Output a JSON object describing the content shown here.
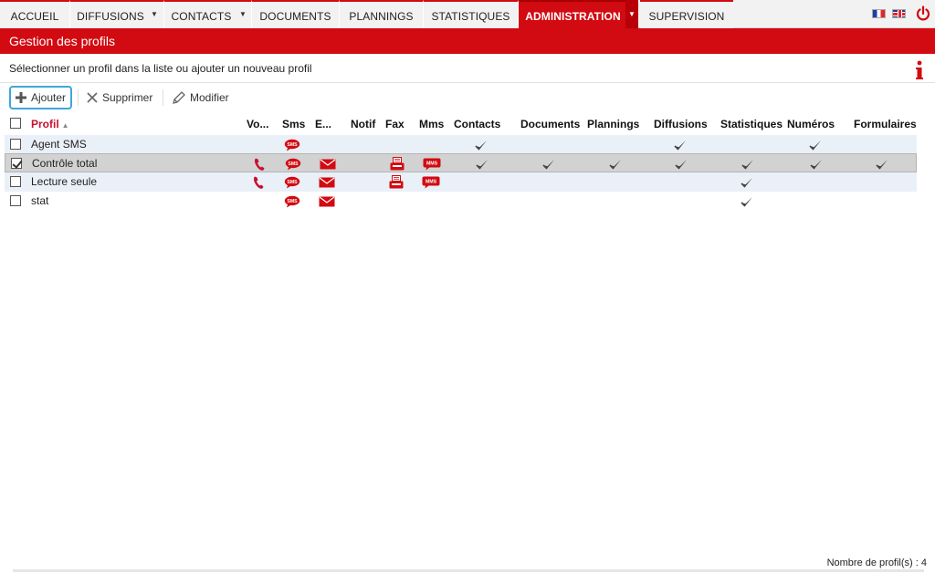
{
  "nav": {
    "tabs": [
      {
        "label": "ACCUEIL",
        "name": "tab-accueil"
      },
      {
        "label": "DIFFUSIONS",
        "name": "tab-diffusions",
        "dropdown": true
      },
      {
        "label": "CONTACTS",
        "name": "tab-contacts",
        "dropdown": true
      },
      {
        "label": "DOCUMENTS",
        "name": "tab-documents"
      },
      {
        "label": "PLANNINGS",
        "name": "tab-plannings"
      },
      {
        "label": "STATISTIQUES",
        "name": "tab-statistiques"
      },
      {
        "label": "ADMINISTRATION",
        "name": "tab-administration",
        "dropdown": true,
        "active": true
      },
      {
        "label": "SUPERVISION",
        "name": "tab-supervision"
      }
    ]
  },
  "page": {
    "title": "Gestion des profils",
    "subtitle": "Sélectionner un profil dans la liste ou ajouter un nouveau profil"
  },
  "toolbar": {
    "add_label": "Ajouter",
    "delete_label": "Supprimer",
    "edit_label": "Modifier"
  },
  "table": {
    "columns": {
      "profil": "Profil",
      "voix": "Vo...",
      "sms": "Sms",
      "email": "E...",
      "notif": "Notif",
      "fax": "Fax",
      "mms": "Mms",
      "contacts": "Contacts",
      "documents": "Documents",
      "plannings": "Plannings",
      "diffusions": "Diffusions",
      "statistiques": "Statistiques",
      "numeros": "Numéros",
      "formulaires": "Formulaires"
    },
    "rows": [
      {
        "name": "Agent SMS",
        "checked": false,
        "voix": false,
        "sms": true,
        "email": false,
        "notif": false,
        "fax": false,
        "mms": false,
        "contacts": true,
        "documents": false,
        "plannings": false,
        "diffusions": true,
        "statistiques": false,
        "numeros": true,
        "formulaires": false
      },
      {
        "name": "Contrôle total",
        "checked": true,
        "voix": true,
        "sms": true,
        "email": true,
        "notif": false,
        "fax": true,
        "mms": true,
        "contacts": true,
        "documents": true,
        "plannings": true,
        "diffusions": true,
        "statistiques": true,
        "numeros": true,
        "formulaires": true
      },
      {
        "name": "Lecture seule",
        "checked": false,
        "voix": true,
        "sms": true,
        "email": true,
        "notif": false,
        "fax": true,
        "mms": true,
        "contacts": false,
        "documents": false,
        "plannings": false,
        "diffusions": false,
        "statistiques": true,
        "numeros": false,
        "formulaires": false
      },
      {
        "name": "stat",
        "checked": false,
        "voix": false,
        "sms": true,
        "email": true,
        "notif": false,
        "fax": false,
        "mms": false,
        "contacts": false,
        "documents": false,
        "plannings": false,
        "diffusions": false,
        "statistiques": true,
        "numeros": false,
        "formulaires": false
      }
    ]
  },
  "icons": {
    "sms_text": "SMS",
    "mms_text": "MMS"
  },
  "footer": {
    "count_text": "Nombre de profil(s) : 4"
  },
  "colors": {
    "brand_red": "#d20a11",
    "selection_blue": "#3fa6dc"
  }
}
